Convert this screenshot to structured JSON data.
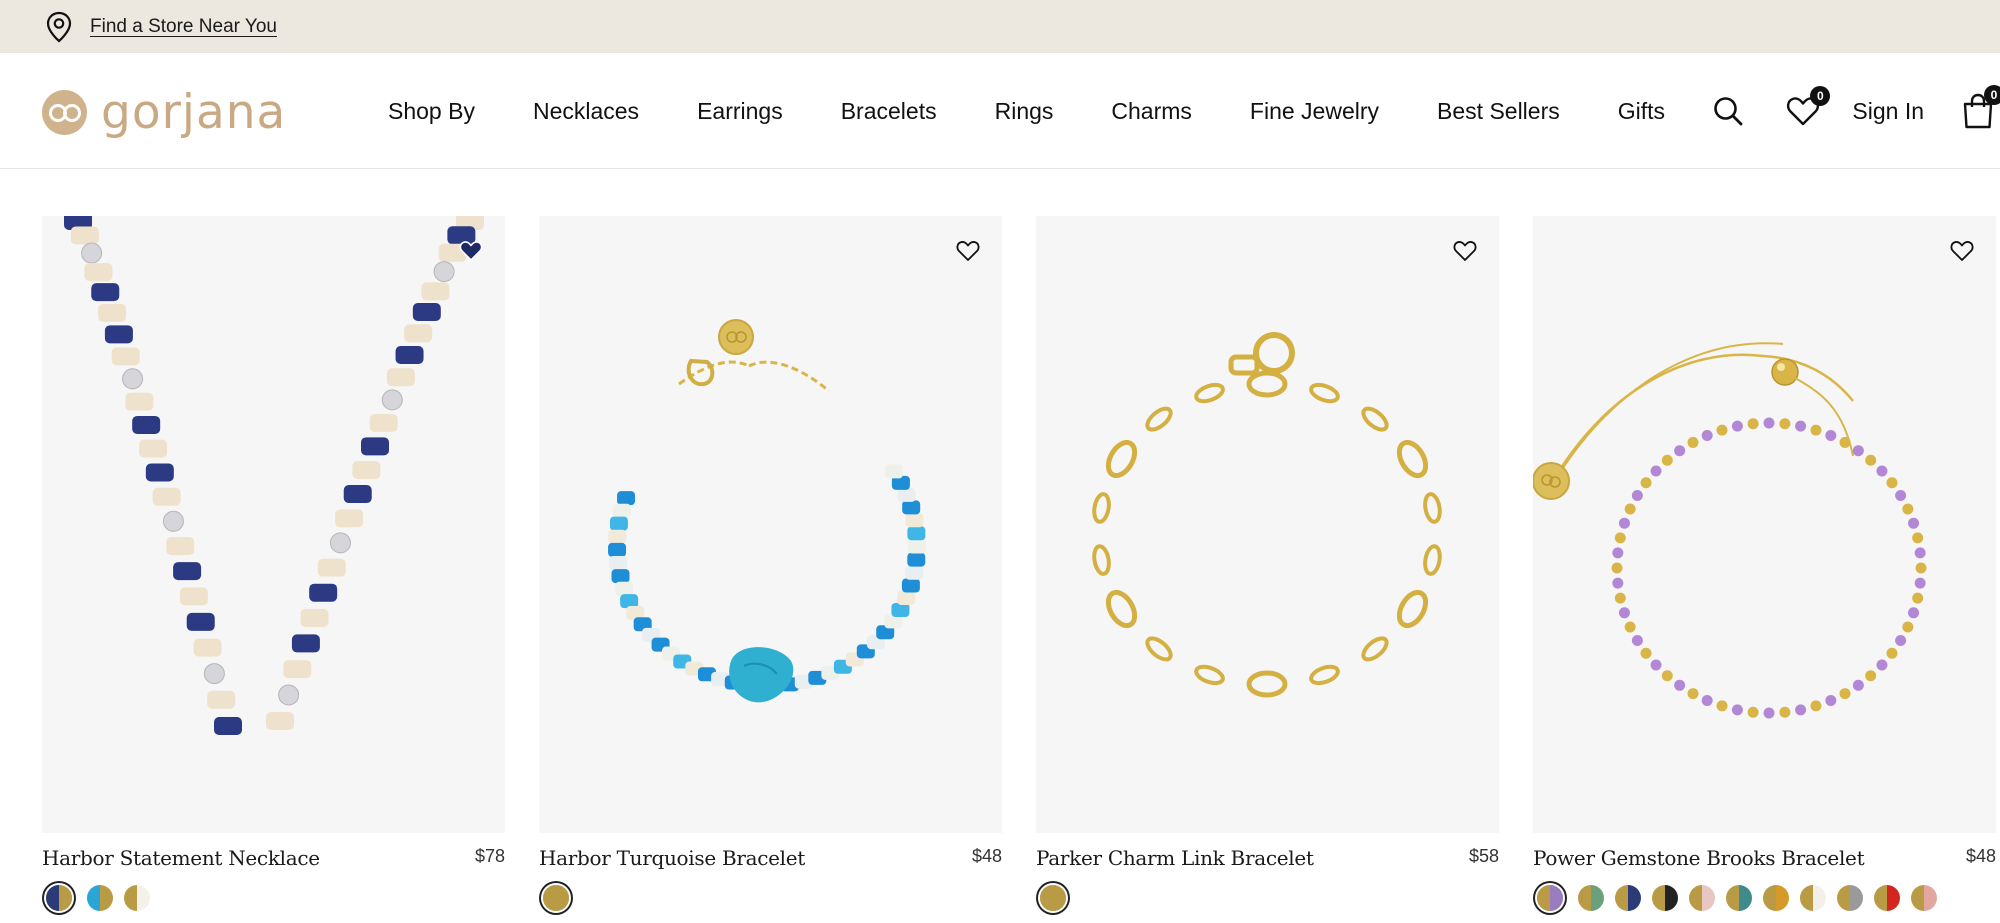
{
  "utility": {
    "store_link": "Find a Store Near You"
  },
  "header": {
    "logo_text": "gorjana",
    "nav": [
      "Shop By",
      "Necklaces",
      "Earrings",
      "Bracelets",
      "Rings",
      "Charms",
      "Fine Jewelry",
      "Best Sellers",
      "Gifts"
    ],
    "sign_in": "Sign In",
    "wishlist_count": "0",
    "bag_count": "0"
  },
  "products": [
    {
      "name": "Harbor Statement Necklace",
      "price": "$78",
      "image_icon": "beaded-necklace-image",
      "swatches": [
        [
          "#2b3b78",
          "#b99a45"
        ],
        [
          "#2aa6d6",
          "#b99a45"
        ],
        [
          "#b99a45",
          "#f4f1ea"
        ]
      ]
    },
    {
      "name": "Harbor Turquoise Bracelet",
      "price": "$48",
      "image_icon": "turquoise-bracelet-image",
      "swatches": [
        [
          "#b99a45",
          "#b99a45"
        ]
      ]
    },
    {
      "name": "Parker Charm Link Bracelet",
      "price": "$58",
      "image_icon": "chain-link-bracelet-image",
      "swatches": [
        [
          "#b99a45",
          "#b99a45"
        ]
      ]
    },
    {
      "name": "Power Gemstone Brooks Bracelet",
      "price": "$48",
      "image_icon": "gemstone-bracelet-image",
      "swatches": [
        [
          "#b99a45",
          "#9a7cc1"
        ],
        [
          "#b99a45",
          "#6aa07c"
        ],
        [
          "#b99a45",
          "#2b3b78"
        ],
        [
          "#b99a45",
          "#222222"
        ],
        [
          "#b99a45",
          "#e8c7c2"
        ],
        [
          "#b99a45",
          "#3f8a8c"
        ],
        [
          "#b99a45",
          "#d59a2a"
        ],
        [
          "#b99a45",
          "#f3f0ea"
        ],
        [
          "#b99a45",
          "#9a9a9a"
        ],
        [
          "#b99a45",
          "#d3261f"
        ],
        [
          "#b99a45",
          "#e2a7a0"
        ]
      ]
    }
  ],
  "colors": {
    "utility_bg": "#ece7df",
    "brand": "#c9a983",
    "image_bg": "#f6f6f6",
    "gold": "#d9b548"
  }
}
